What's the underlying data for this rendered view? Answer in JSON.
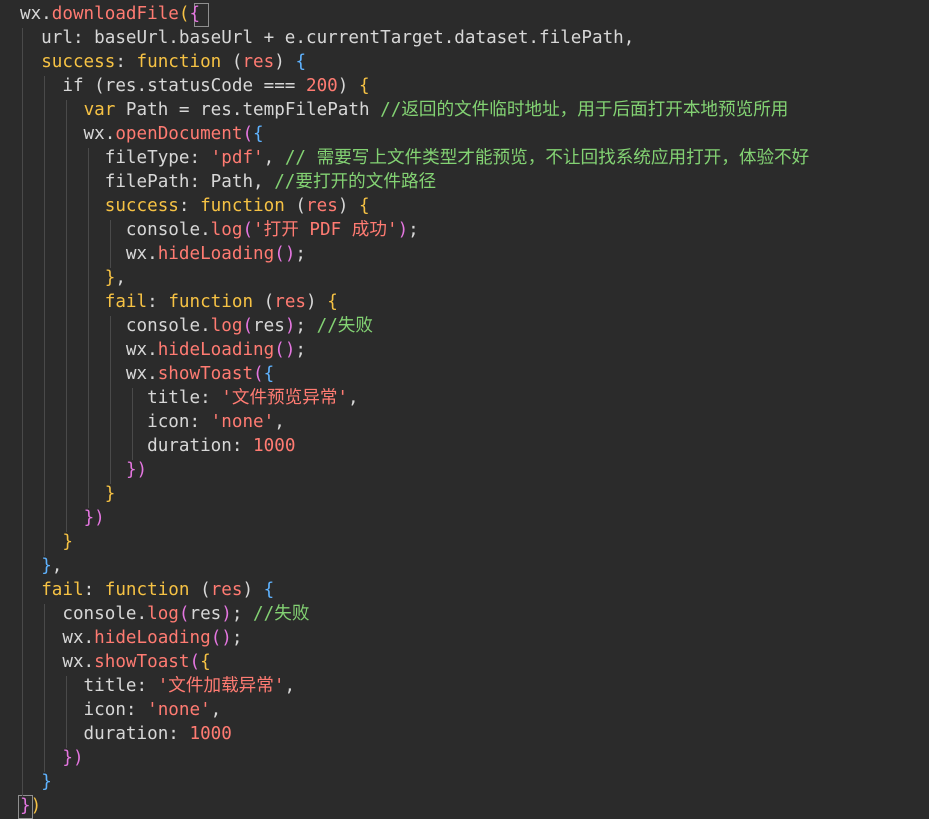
{
  "editor": {
    "colors": {
      "background": "#2b2b2b",
      "default": "#d7d7d7",
      "keyword": "#f6c244",
      "function": "#ff7b72",
      "string": "#ff7b72",
      "number": "#ff7b72",
      "comment": "#83d273",
      "brace_yellow": "#f6c244",
      "brace_purple": "#e476e0",
      "brace_blue": "#5fb3ff"
    },
    "lines": [
      [
        {
          "t": "wx.",
          "c": "default"
        },
        {
          "t": "downloadFile",
          "c": "func"
        },
        {
          "t": "(",
          "c": "brace-y"
        },
        {
          "t": "{",
          "c": "brace-p"
        }
      ],
      [
        {
          "t": "  url: baseUrl.baseUrl + e.currentTarget.dataset.filePath,",
          "c": "default"
        }
      ],
      [
        {
          "t": "  ",
          "c": "default"
        },
        {
          "t": "success",
          "c": "keyword"
        },
        {
          "t": ": ",
          "c": "default"
        },
        {
          "t": "function",
          "c": "keyword"
        },
        {
          "t": " (",
          "c": "default"
        },
        {
          "t": "res",
          "c": "param"
        },
        {
          "t": ") ",
          "c": "default"
        },
        {
          "t": "{",
          "c": "brace-b"
        }
      ],
      [
        {
          "t": "    if (res.statusCode === ",
          "c": "default"
        },
        {
          "t": "200",
          "c": "number"
        },
        {
          "t": ") ",
          "c": "default"
        },
        {
          "t": "{",
          "c": "brace-y"
        }
      ],
      [
        {
          "t": "      ",
          "c": "default"
        },
        {
          "t": "var",
          "c": "keyword"
        },
        {
          "t": " Path = res.tempFilePath ",
          "c": "default"
        },
        {
          "t": "//返回的文件临时地址，用于后面打开本地预览所用",
          "c": "comment"
        }
      ],
      [
        {
          "t": "      wx.",
          "c": "default"
        },
        {
          "t": "openDocument",
          "c": "func"
        },
        {
          "t": "(",
          "c": "brace-p"
        },
        {
          "t": "{",
          "c": "brace-b"
        }
      ],
      [
        {
          "t": "        fileType: ",
          "c": "default"
        },
        {
          "t": "'pdf'",
          "c": "string"
        },
        {
          "t": ", ",
          "c": "default"
        },
        {
          "t": "// 需要写上文件类型才能预览，不让回找系统应用打开，体验不好",
          "c": "comment"
        }
      ],
      [
        {
          "t": "        filePath: Path, ",
          "c": "default"
        },
        {
          "t": "//要打开的文件路径",
          "c": "comment"
        }
      ],
      [
        {
          "t": "        ",
          "c": "default"
        },
        {
          "t": "success",
          "c": "keyword"
        },
        {
          "t": ": ",
          "c": "default"
        },
        {
          "t": "function",
          "c": "keyword"
        },
        {
          "t": " (",
          "c": "default"
        },
        {
          "t": "res",
          "c": "param"
        },
        {
          "t": ") ",
          "c": "default"
        },
        {
          "t": "{",
          "c": "brace-y"
        }
      ],
      [
        {
          "t": "          console.",
          "c": "default"
        },
        {
          "t": "log",
          "c": "func"
        },
        {
          "t": "(",
          "c": "brace-p"
        },
        {
          "t": "'打开 PDF 成功'",
          "c": "string"
        },
        {
          "t": ")",
          "c": "brace-p"
        },
        {
          "t": ";",
          "c": "default"
        }
      ],
      [
        {
          "t": "          wx.",
          "c": "default"
        },
        {
          "t": "hideLoading",
          "c": "func"
        },
        {
          "t": "()",
          "c": "brace-p"
        },
        {
          "t": ";",
          "c": "default"
        }
      ],
      [
        {
          "t": "        ",
          "c": "default"
        },
        {
          "t": "}",
          "c": "brace-y"
        },
        {
          "t": ",",
          "c": "default"
        }
      ],
      [
        {
          "t": "        ",
          "c": "default"
        },
        {
          "t": "fail",
          "c": "keyword"
        },
        {
          "t": ": ",
          "c": "default"
        },
        {
          "t": "function",
          "c": "keyword"
        },
        {
          "t": " (",
          "c": "default"
        },
        {
          "t": "res",
          "c": "param"
        },
        {
          "t": ") ",
          "c": "default"
        },
        {
          "t": "{",
          "c": "brace-y"
        }
      ],
      [
        {
          "t": "          console.",
          "c": "default"
        },
        {
          "t": "log",
          "c": "func"
        },
        {
          "t": "(",
          "c": "brace-p"
        },
        {
          "t": "res",
          "c": "default"
        },
        {
          "t": ")",
          "c": "brace-p"
        },
        {
          "t": "; ",
          "c": "default"
        },
        {
          "t": "//失败",
          "c": "comment"
        }
      ],
      [
        {
          "t": "          wx.",
          "c": "default"
        },
        {
          "t": "hideLoading",
          "c": "func"
        },
        {
          "t": "()",
          "c": "brace-p"
        },
        {
          "t": ";",
          "c": "default"
        }
      ],
      [
        {
          "t": "          wx.",
          "c": "default"
        },
        {
          "t": "showToast",
          "c": "func"
        },
        {
          "t": "(",
          "c": "brace-p"
        },
        {
          "t": "{",
          "c": "brace-b"
        }
      ],
      [
        {
          "t": "            title: ",
          "c": "default"
        },
        {
          "t": "'文件预览异常'",
          "c": "string"
        },
        {
          "t": ",",
          "c": "default"
        }
      ],
      [
        {
          "t": "            icon: ",
          "c": "default"
        },
        {
          "t": "'none'",
          "c": "string"
        },
        {
          "t": ",",
          "c": "default"
        }
      ],
      [
        {
          "t": "            duration: ",
          "c": "default"
        },
        {
          "t": "1000",
          "c": "number"
        }
      ],
      [
        {
          "t": "          ",
          "c": "default"
        },
        {
          "t": "})",
          "c": "brace-p"
        }
      ],
      [
        {
          "t": "        ",
          "c": "default"
        },
        {
          "t": "}",
          "c": "brace-y"
        }
      ],
      [
        {
          "t": "      ",
          "c": "default"
        },
        {
          "t": "})",
          "c": "brace-p"
        }
      ],
      [
        {
          "t": "    ",
          "c": "default"
        },
        {
          "t": "}",
          "c": "brace-y"
        }
      ],
      [
        {
          "t": "  ",
          "c": "default"
        },
        {
          "t": "}",
          "c": "brace-b"
        },
        {
          "t": ",",
          "c": "default"
        }
      ],
      [
        {
          "t": "  ",
          "c": "default"
        },
        {
          "t": "fail",
          "c": "keyword"
        },
        {
          "t": ": ",
          "c": "default"
        },
        {
          "t": "function",
          "c": "keyword"
        },
        {
          "t": " (",
          "c": "default"
        },
        {
          "t": "res",
          "c": "param"
        },
        {
          "t": ") ",
          "c": "default"
        },
        {
          "t": "{",
          "c": "brace-b"
        }
      ],
      [
        {
          "t": "    console.",
          "c": "default"
        },
        {
          "t": "log",
          "c": "func"
        },
        {
          "t": "(",
          "c": "brace-p"
        },
        {
          "t": "res",
          "c": "default"
        },
        {
          "t": ")",
          "c": "brace-p"
        },
        {
          "t": "; ",
          "c": "default"
        },
        {
          "t": "//失败",
          "c": "comment"
        }
      ],
      [
        {
          "t": "    wx.",
          "c": "default"
        },
        {
          "t": "hideLoading",
          "c": "func"
        },
        {
          "t": "()",
          "c": "brace-p"
        },
        {
          "t": ";",
          "c": "default"
        }
      ],
      [
        {
          "t": "    wx.",
          "c": "default"
        },
        {
          "t": "showToast",
          "c": "func"
        },
        {
          "t": "(",
          "c": "brace-p"
        },
        {
          "t": "{",
          "c": "brace-y"
        }
      ],
      [
        {
          "t": "      title: ",
          "c": "default"
        },
        {
          "t": "'文件加载异常'",
          "c": "string"
        },
        {
          "t": ",",
          "c": "default"
        }
      ],
      [
        {
          "t": "      icon: ",
          "c": "default"
        },
        {
          "t": "'none'",
          "c": "string"
        },
        {
          "t": ",",
          "c": "default"
        }
      ],
      [
        {
          "t": "      duration: ",
          "c": "default"
        },
        {
          "t": "1000",
          "c": "number"
        }
      ],
      [
        {
          "t": "    ",
          "c": "default"
        },
        {
          "t": "})",
          "c": "brace-p"
        }
      ],
      [
        {
          "t": "  ",
          "c": "default"
        },
        {
          "t": "}",
          "c": "brace-b"
        }
      ],
      [
        {
          "t": "}",
          "c": "brace-p"
        },
        {
          "t": ")",
          "c": "brace-y"
        }
      ]
    ]
  }
}
